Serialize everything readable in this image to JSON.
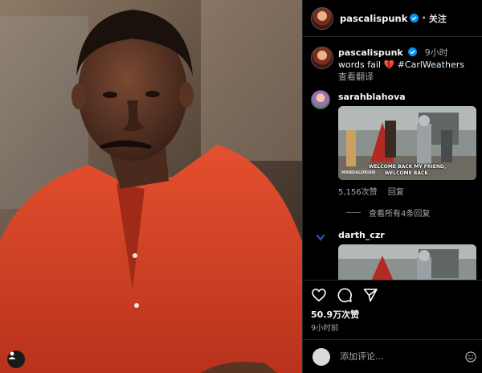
{
  "post": {
    "author": "pascalispunk",
    "follow_label": "关注",
    "separator": "•",
    "photo_alt": ""
  },
  "caption": {
    "username": "pascalispunk",
    "time": "9小时",
    "text_prefix": "words fail",
    "emoji": "💔",
    "hashtag": "#CarlWeathers",
    "translate_label": "查看翻译"
  },
  "comments": [
    {
      "username": "sarahblahova",
      "gif_caption": [
        "WELCOME BACK MY FRIEND,",
        "WELCOME BACK."
      ],
      "gif_watermark": "MANDALORIAN",
      "likes": "5,156次赞",
      "reply_label": "回复",
      "view_replies": "查看所有4条回复"
    },
    {
      "username": "darth_czr"
    }
  ],
  "actions": {
    "likes_count": "50.9万次赞",
    "time_ago": "9小时前"
  },
  "add_comment": {
    "placeholder": "添加评论..."
  },
  "colors": {
    "background": "#000000",
    "text": "#f5f5f5",
    "muted": "#a8a8a8",
    "verified": "#0095f6",
    "shirt": "#d9442a"
  }
}
